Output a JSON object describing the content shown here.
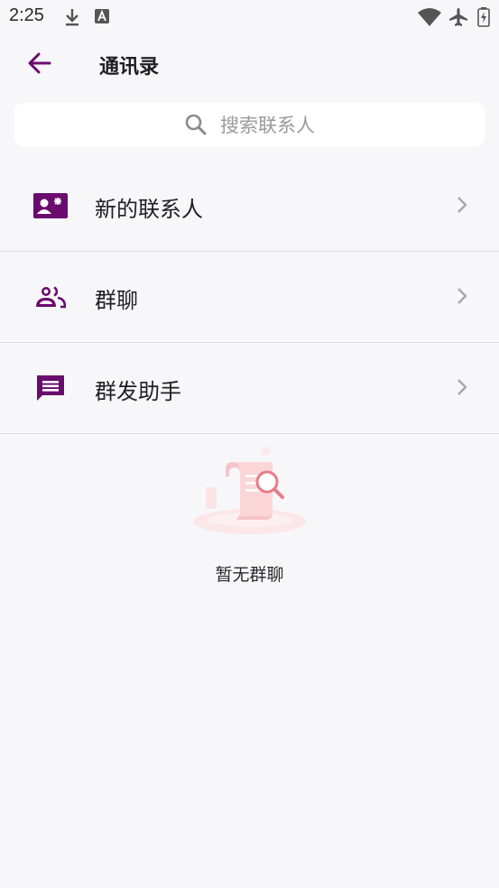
{
  "status_bar": {
    "time": "2:25",
    "icons": [
      "download-icon",
      "keyboard-a-icon",
      "wifi-icon",
      "airplane-icon",
      "battery-icon"
    ]
  },
  "header": {
    "title": "通讯录",
    "back_icon": "arrow-left-icon"
  },
  "search": {
    "placeholder": "搜索联系人",
    "icon": "search-icon"
  },
  "menu": [
    {
      "label": "新的联系人",
      "icon": "contact-card-icon"
    },
    {
      "label": "群聊",
      "icon": "group-icon"
    },
    {
      "label": "群发助手",
      "icon": "message-icon"
    }
  ],
  "empty_state": {
    "text": "暂无群聊",
    "illustration": "empty-document-search-illustration"
  },
  "colors": {
    "accent": "#6a0b6e",
    "background": "#f7f7f9",
    "divider": "#dcdcdf",
    "chevron": "#a8a8ac"
  }
}
